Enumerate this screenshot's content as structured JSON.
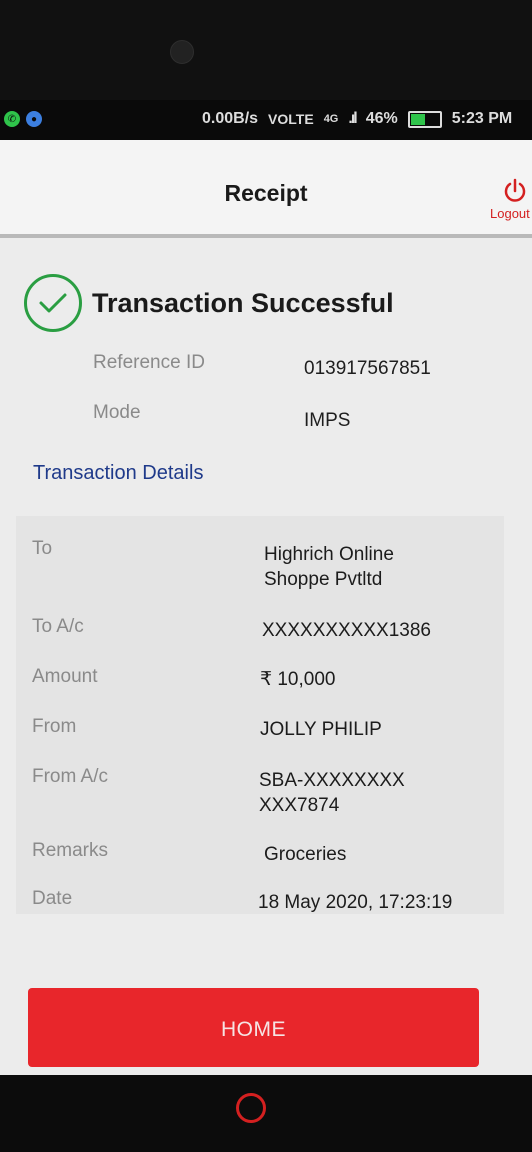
{
  "status_bar": {
    "speed": "0.00B/s",
    "volte": "VOLTE",
    "network": "4G",
    "battery": "46%",
    "battery_level": 0.46,
    "time": "5:23 PM"
  },
  "header": {
    "title": "Receipt",
    "logout_label": "Logout"
  },
  "success": {
    "message": "Transaction Successful",
    "color": "#2a9e42"
  },
  "summary": [
    {
      "label": "Reference ID",
      "value": "013917567851"
    },
    {
      "label": "Mode",
      "value": "IMPS"
    }
  ],
  "details_title": "Transaction Details",
  "details": [
    {
      "label": "To",
      "value": "Highrich Online Shoppe Pvtltd"
    },
    {
      "label": "To A/c",
      "value": "XXXXXXXXXX1386"
    },
    {
      "label": "Amount",
      "value": "₹ 10,000"
    },
    {
      "label": "From",
      "value": "JOLLY PHILIP"
    },
    {
      "label": "From A/c",
      "value": "SBA-XXXXXXXXXXX7874"
    },
    {
      "label": "Remarks",
      "value": "Groceries"
    },
    {
      "label": "Date",
      "value": "18 May 2020, 17:23:19"
    }
  ],
  "home_button": "HOME",
  "colors": {
    "accent": "#e8262b",
    "link": "#1f3a8a"
  }
}
